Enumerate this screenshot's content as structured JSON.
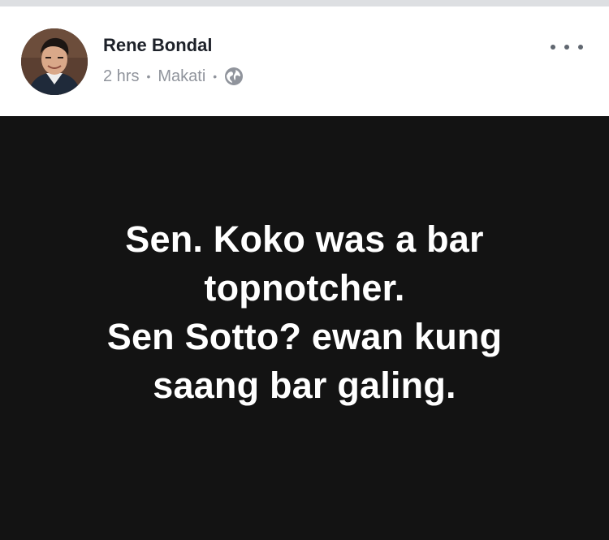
{
  "post": {
    "author": {
      "name": "Rene Bondal",
      "avatar_icon": "person-photo-avatar"
    },
    "meta": {
      "time": "2 hrs",
      "separator": "•",
      "location": "Makati",
      "privacy_icon": "globe-icon"
    },
    "menu": {
      "icon": "more-options-icon"
    },
    "content": {
      "background_color": "#131313",
      "text_color": "#ffffff",
      "lines": [
        "Sen. Koko was a bar",
        "topnotcher.",
        "Sen Sotto? ewan kung",
        "saang bar galing."
      ]
    }
  }
}
